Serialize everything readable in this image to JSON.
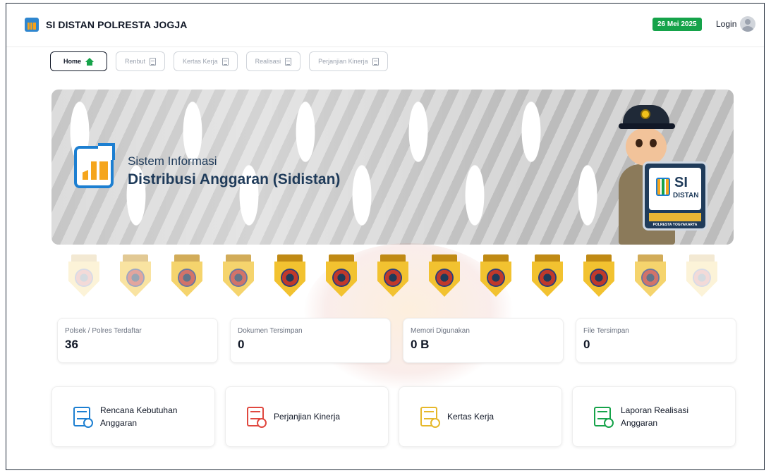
{
  "header": {
    "title": "SI DISTAN POLRESTA JOGJA",
    "date": "26 Mei 2025",
    "login_label": "Login"
  },
  "tabs": [
    {
      "label": "Home",
      "active": true,
      "icon": "home-icon"
    },
    {
      "label": "Renbut",
      "active": false,
      "icon": "document-icon"
    },
    {
      "label": "Kertas Kerja",
      "active": false,
      "icon": "document-icon"
    },
    {
      "label": "Realisasi",
      "active": false,
      "icon": "document-icon"
    },
    {
      "label": "Perjanjian Kinerja",
      "active": false,
      "icon": "document-icon"
    }
  ],
  "hero": {
    "subtitle": "Sistem Informasi",
    "title": "Distribusi Anggaran (Sidistan)",
    "mascot_sign": {
      "si": "SI",
      "distan": "DISTAN",
      "footer": "POLRESTA YOGYAKARTA"
    }
  },
  "stats": [
    {
      "label": "Polsek / Polres Terdaftar",
      "value": "36"
    },
    {
      "label": "Dokumen Tersimpan",
      "value": "0"
    },
    {
      "label": "Memori Digunakan",
      "value": "0 B"
    },
    {
      "label": "File Tersimpan",
      "value": "0"
    }
  ],
  "cards": [
    {
      "label": "Rencana Kebutuhan Anggaran",
      "icon": "budget-document-icon",
      "color": "#1d7fd1"
    },
    {
      "label": "Perjanjian Kinerja",
      "icon": "agreement-document-icon",
      "color": "#e0483f"
    },
    {
      "label": "Kertas Kerja",
      "icon": "worksheet-icon",
      "color": "#e6b82b"
    },
    {
      "label": "Laporan Realisasi Anggaran",
      "icon": "report-document-icon",
      "color": "#16a34a"
    }
  ],
  "colors": {
    "accent": "#1d7fd1",
    "date_badge": "#15a34a",
    "hero_text": "#1f3b5a"
  }
}
